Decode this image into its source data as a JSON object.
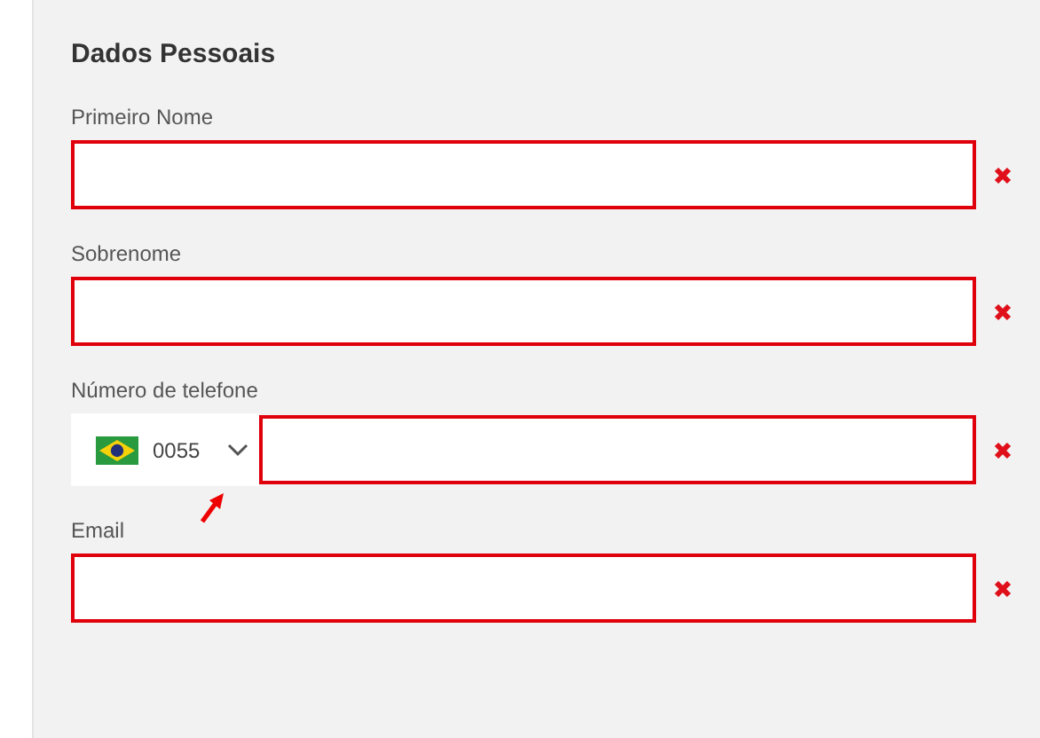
{
  "section_title": "Dados Pessoais",
  "fields": [
    {
      "kind": "text",
      "label": "Primeiro Nome",
      "invalid": true
    },
    {
      "kind": "text",
      "label": "Sobrenome",
      "invalid": true
    },
    {
      "kind": "phone",
      "label": "Número de telefone",
      "invalid": true,
      "country_code": "0055"
    },
    {
      "kind": "text",
      "label": "Email",
      "invalid": true
    }
  ]
}
